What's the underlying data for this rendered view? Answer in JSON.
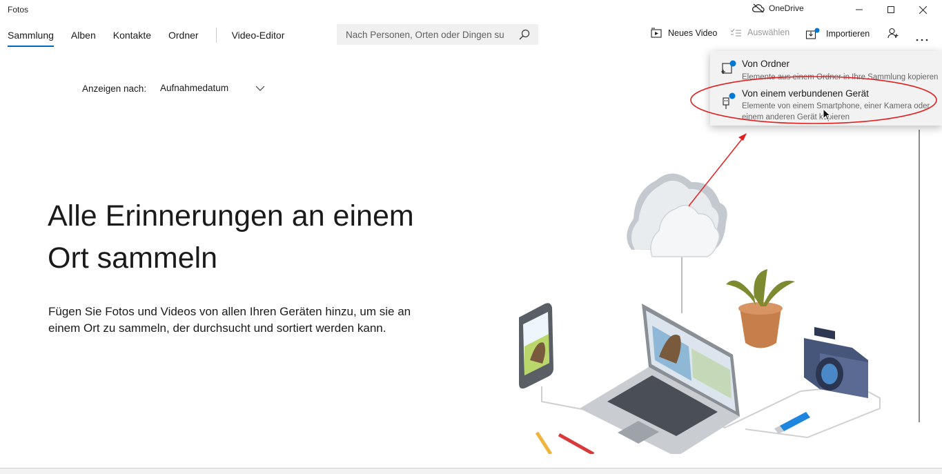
{
  "app": {
    "title": "Fotos"
  },
  "onedrive": {
    "label": "OneDrive"
  },
  "nav": {
    "tabs": [
      {
        "label": "Sammlung",
        "active": true
      },
      {
        "label": "Alben"
      },
      {
        "label": "Kontakte"
      },
      {
        "label": "Ordner"
      },
      {
        "label": "Video-Editor"
      }
    ]
  },
  "search": {
    "placeholder": "Nach Personen, Orten oder Dingen su"
  },
  "toolbar": {
    "new_video": "Neues Video",
    "select": "Auswählen",
    "import": "Importieren"
  },
  "sort": {
    "label": "Anzeigen nach:",
    "value": "Aufnahmedatum"
  },
  "hero": {
    "line1": "Alle Erinnerungen an einem",
    "line2": "Ort sammeln",
    "desc_line1": "Fügen Sie Fotos und Videos von allen Ihren Geräten hinzu, um sie an",
    "desc_line2": "einem Ort zu sammeln, der durchsucht und sortiert werden kann."
  },
  "flyout": {
    "items": [
      {
        "title": "Von Ordner",
        "desc": "Elemente aus einem Ordner in Ihre Sammlung kopieren"
      },
      {
        "title": "Von einem verbundenen Gerät",
        "desc_line1": "Elemente von einem Smartphone, einer Kamera oder",
        "desc_line2": "einem anderen Gerät kopieren"
      }
    ]
  },
  "colors": {
    "accent": "#0067c0",
    "badge": "#0078d4",
    "annotation": "#e02020"
  }
}
